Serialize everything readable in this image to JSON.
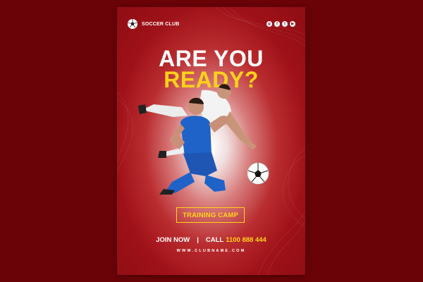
{
  "brand": {
    "name": "SOCCER CLUB",
    "logo_icon": "soccer-ball-icon"
  },
  "social_icons": [
    "instagram-icon",
    "facebook-icon",
    "twitter-icon",
    "youtube-icon"
  ],
  "headline": {
    "line1": "ARE YOU",
    "line2": "READY?"
  },
  "cta": {
    "label": "TRAINING CAMP"
  },
  "contact": {
    "join": "JOIN NOW",
    "separator": "|",
    "call": "CALL",
    "phone": "1100 888 444"
  },
  "website": "WWW.CLUBNAME.COM",
  "colors": {
    "background": "#6a0307",
    "poster": "#9f1118",
    "accent": "#ffd21a",
    "text": "#ffffff"
  }
}
